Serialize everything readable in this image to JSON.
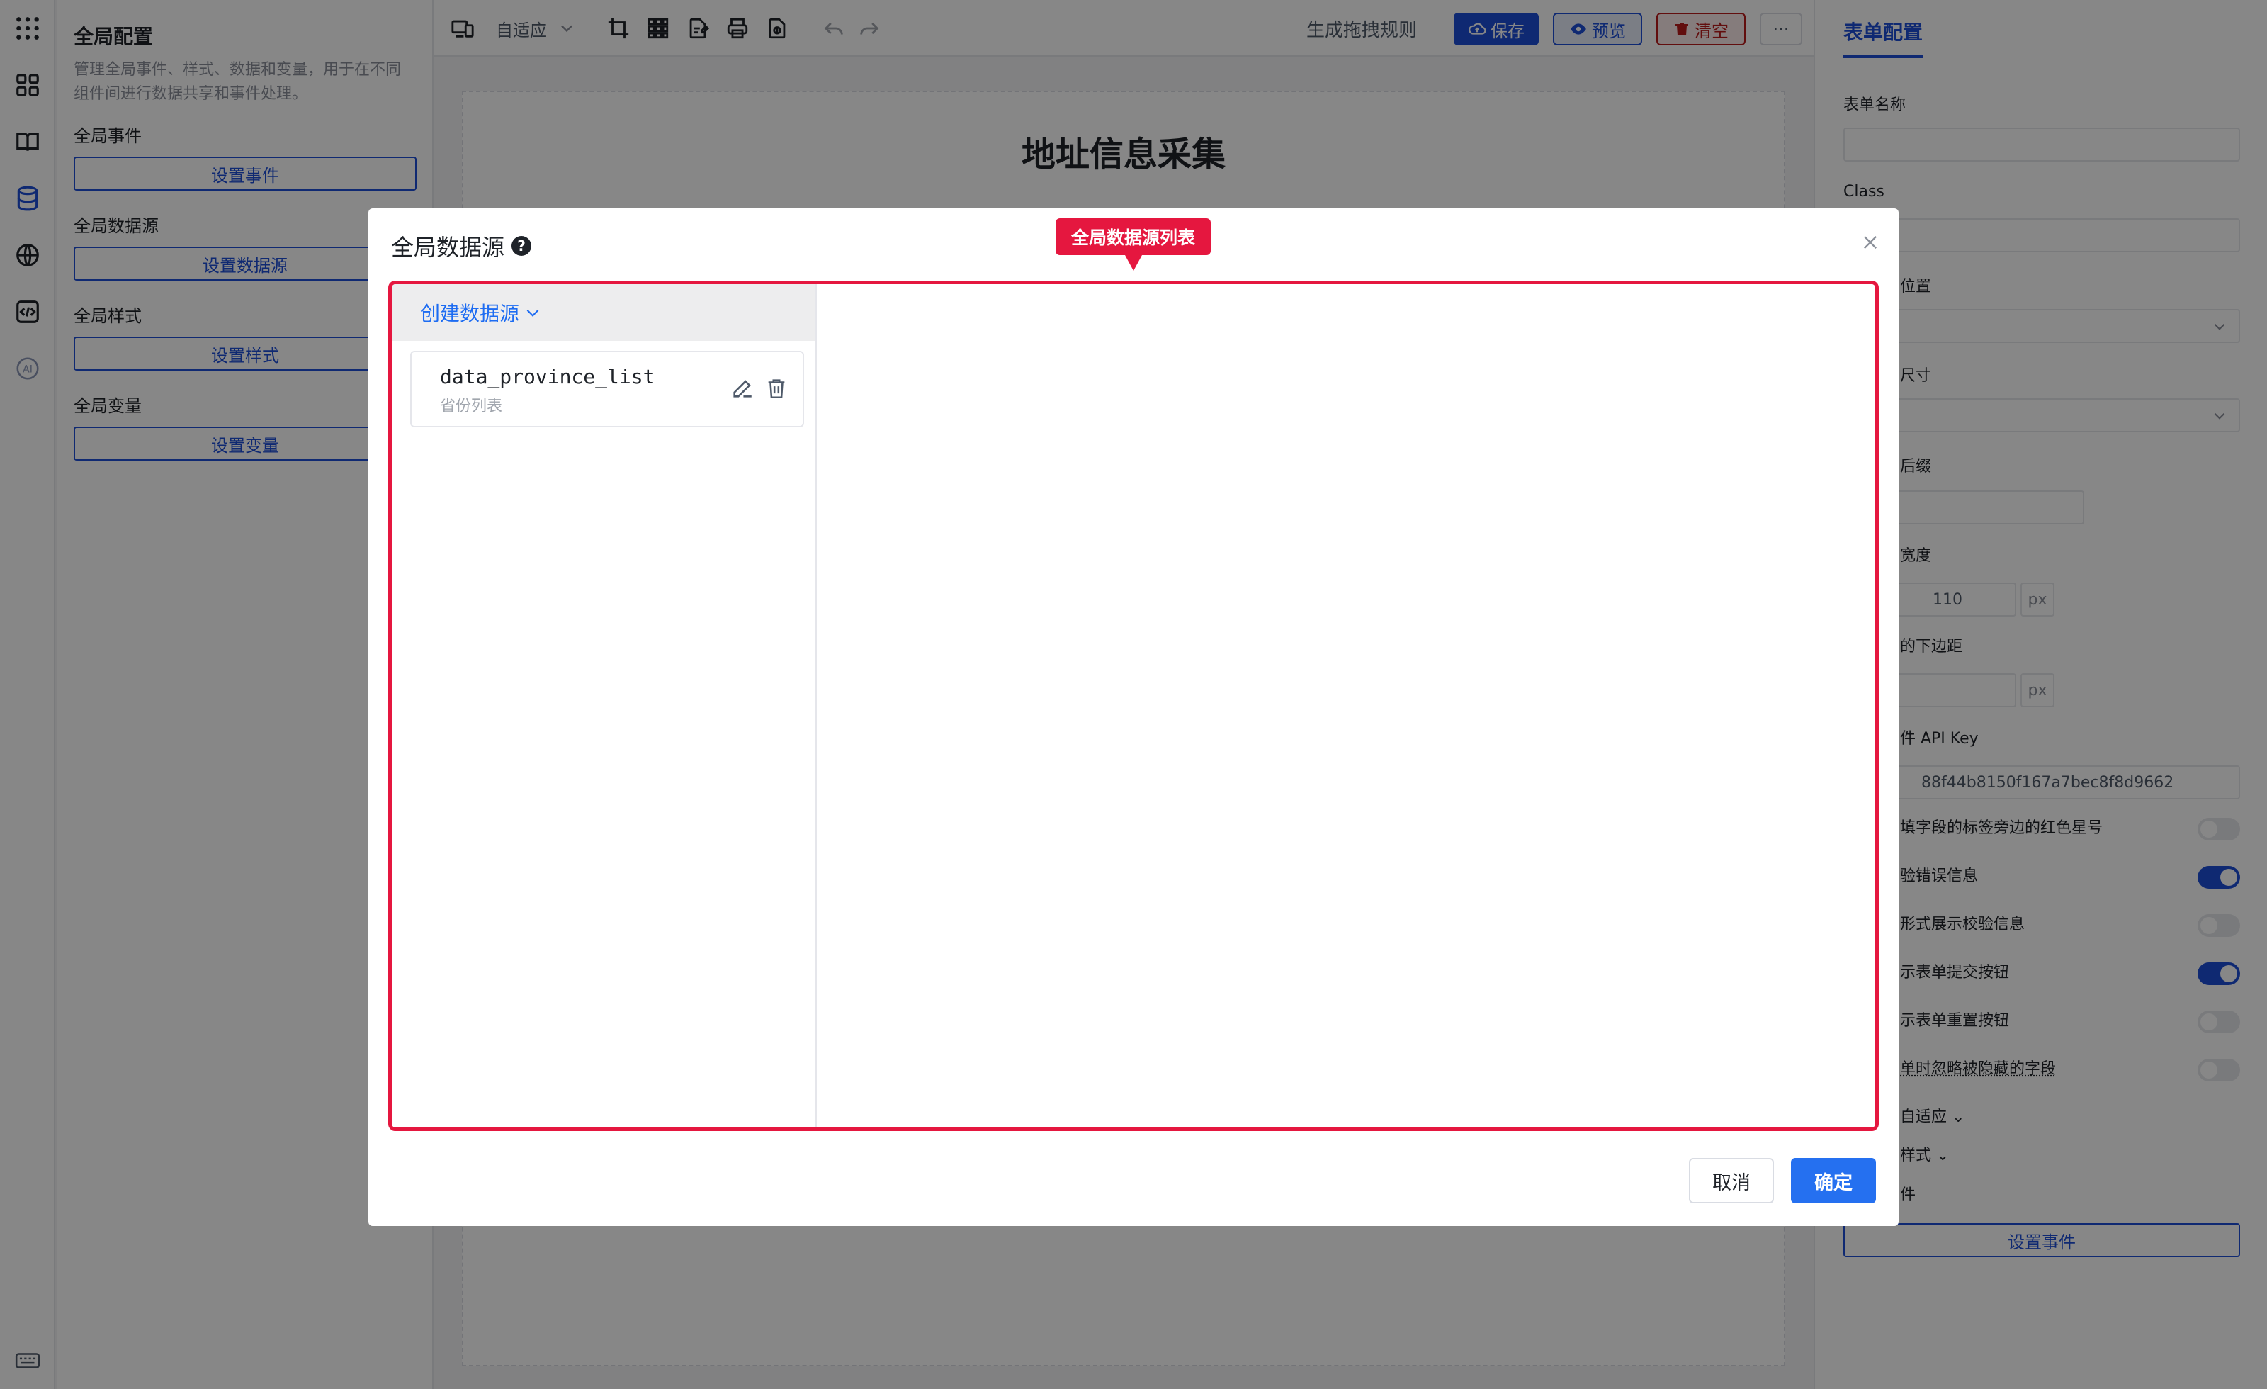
{
  "left_panel": {
    "title": "全局配置",
    "description": "管理全局事件、样式、数据和变量，用于在不同组件间进行数据共享和事件处理。",
    "sections": [
      {
        "label": "全局事件",
        "button": "设置事件"
      },
      {
        "label": "全局数据源",
        "button": "设置数据源"
      },
      {
        "label": "全局样式",
        "button": "设置样式"
      },
      {
        "label": "全局变量",
        "button": "设置变量"
      }
    ]
  },
  "toolbar": {
    "device_mode": "自适应",
    "generate_rules": "生成拖拽规则",
    "save": "保存",
    "preview": "预览",
    "clear": "清空",
    "more": "···"
  },
  "canvas": {
    "form_title": "地址信息采集"
  },
  "right_panel": {
    "tab": "表单配置",
    "form_name_label": "表单名称",
    "class_label": "Class",
    "label_position_label": "位置",
    "size_label": "尺寸",
    "suffix_label": "后缀",
    "width_label": "宽度",
    "width_value": "110",
    "width_unit": "px",
    "margin_label": "的下边距",
    "margin_unit": "px",
    "api_key_label": "件 API Key",
    "api_key_value": "88f44b8150f167a7bec8f8d9662",
    "switches": [
      {
        "label": "填字段的标签旁边的红色星号",
        "on": false
      },
      {
        "label": "验错误信息",
        "on": true
      },
      {
        "label": "形式展示校验信息",
        "on": false
      },
      {
        "label": "示表单提交按钮",
        "on": true
      },
      {
        "label": "示表单重置按钮",
        "on": false
      },
      {
        "label": "单时忽略被隐藏的字段",
        "on": false
      }
    ],
    "adaptive_label": "自适应",
    "style_label": "样式",
    "event_label": "件",
    "event_button": "设置事件"
  },
  "modal": {
    "title": "全局数据源",
    "create_button": "创建数据源",
    "callout": "全局数据源列表",
    "datasources": [
      {
        "name": "data_province_list",
        "description": "省份列表"
      }
    ],
    "cancel": "取消",
    "confirm": "确定"
  },
  "colors": {
    "primary": "#1d4ed8",
    "link": "#1d6cf2",
    "confirm": "#2570f0",
    "highlight": "#e5173f",
    "clear_button": "#b91c1c"
  }
}
